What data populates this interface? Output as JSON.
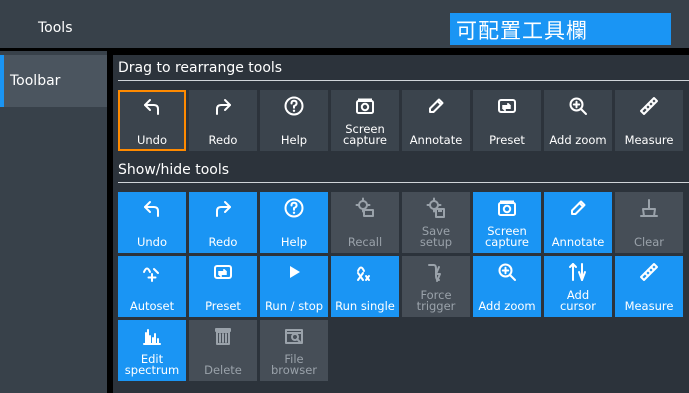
{
  "sidebar": {
    "header": "Tools",
    "tabs": [
      {
        "label": "Toolbar",
        "active": true
      }
    ]
  },
  "header": {
    "badge_text": "可配置工具欄"
  },
  "toolbar_section": {
    "title": "Drag to rearrange tools",
    "tools": [
      {
        "label": "Undo",
        "icon": "undo-icon",
        "selected": true
      },
      {
        "label": "Redo",
        "icon": "redo-icon"
      },
      {
        "label": "Help",
        "icon": "help-icon"
      },
      {
        "label": "Screen capture",
        "icon": "camera-icon"
      },
      {
        "label": "Annotate",
        "icon": "pen-icon"
      },
      {
        "label": "Preset",
        "icon": "preset-icon"
      },
      {
        "label": "Add zoom",
        "icon": "zoom-in-icon"
      },
      {
        "label": "Measure",
        "icon": "ruler-icon"
      }
    ]
  },
  "showhide_section": {
    "title": "Show/hide tools",
    "rows": [
      [
        {
          "label": "Undo",
          "icon": "undo-icon",
          "enabled": true
        },
        {
          "label": "Redo",
          "icon": "redo-icon",
          "enabled": true
        },
        {
          "label": "Help",
          "icon": "help-icon",
          "enabled": true
        },
        {
          "label": "Recall",
          "icon": "recall-icon",
          "enabled": false
        },
        {
          "label": "Save setup",
          "icon": "save-setup-icon",
          "enabled": false
        },
        {
          "label": "Screen capture",
          "icon": "camera-icon",
          "enabled": true
        },
        {
          "label": "Annotate",
          "icon": "pen-icon",
          "enabled": true
        },
        {
          "label": "Clear",
          "icon": "clear-icon",
          "enabled": false
        }
      ],
      [
        {
          "label": "Autoset",
          "icon": "autoset-icon",
          "enabled": true
        },
        {
          "label": "Preset",
          "icon": "preset-icon",
          "enabled": true
        },
        {
          "label": "Run / stop",
          "icon": "play-icon",
          "enabled": true
        },
        {
          "label": "Run single",
          "icon": "run-single-icon",
          "enabled": true
        },
        {
          "label": "Force trigger",
          "icon": "force-trigger-icon",
          "enabled": false
        },
        {
          "label": "Add zoom",
          "icon": "zoom-in-icon",
          "enabled": true
        },
        {
          "label": "Add cursor",
          "icon": "cursor-icon",
          "enabled": true
        },
        {
          "label": "Measure",
          "icon": "ruler-icon",
          "enabled": true
        }
      ],
      [
        {
          "label": "Edit spectrum",
          "icon": "spectrum-icon",
          "enabled": true
        },
        {
          "label": "Delete",
          "icon": "trash-icon",
          "enabled": false
        },
        {
          "label": "File browser",
          "icon": "file-browser-icon",
          "enabled": false
        }
      ]
    ]
  },
  "colors": {
    "accent": "#1a95f4",
    "selection_outline": "#ff8a00",
    "tile_dark": "#3b444d",
    "tile_disabled": "#464e57",
    "panel": "#2c333b"
  }
}
